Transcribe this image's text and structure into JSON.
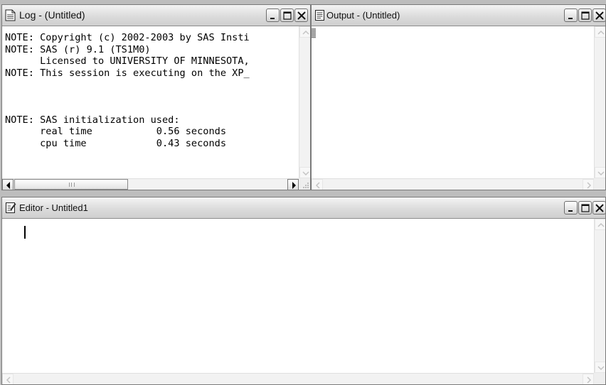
{
  "log": {
    "title": "Log - (Untitled)",
    "lines": [
      "NOTE: Copyright (c) 2002-2003 by SAS Insti",
      "NOTE: SAS (r) 9.1 (TS1M0)",
      "      Licensed to UNIVERSITY OF MINNESOTA,",
      "NOTE: This session is executing on the XP_",
      "",
      "",
      "",
      "NOTE: SAS initialization used:",
      "      real time           0.56 seconds",
      "      cpu time            0.43 seconds"
    ]
  },
  "output": {
    "title": "Output - (Untitled)"
  },
  "editor": {
    "title": "Editor - Untitled1",
    "content": ""
  },
  "icons": {
    "log_window": "log-document-icon",
    "output_window": "output-document-icon",
    "editor_window": "editor-pencil-icon",
    "minimize": "minimize-icon",
    "maximize": "maximize-icon",
    "close": "close-icon"
  },
  "colors": {
    "desktop": "#bdbdbd",
    "titlebar": "#d6d6d6",
    "content": "#ffffff"
  }
}
